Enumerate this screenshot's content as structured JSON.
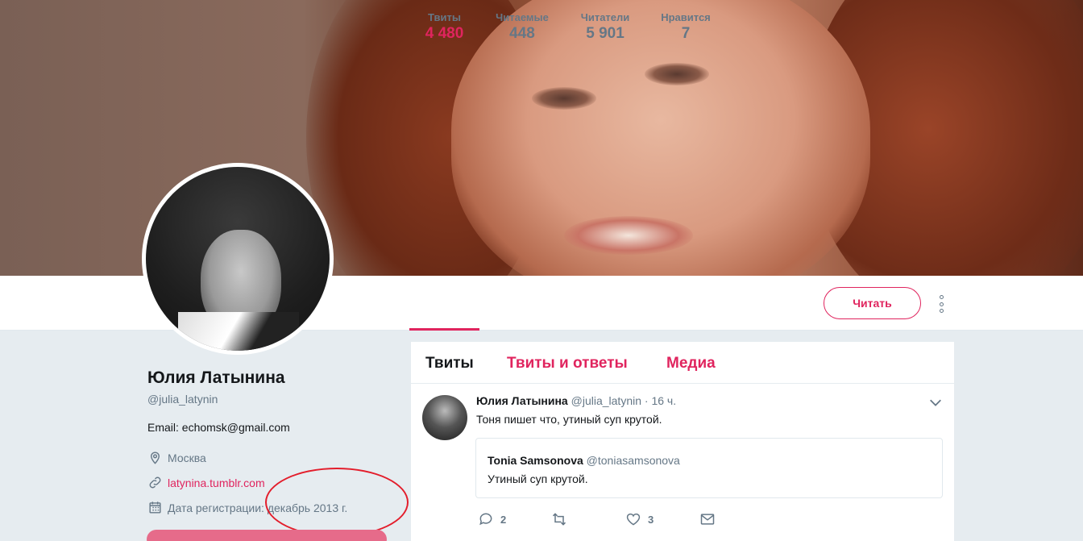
{
  "colors": {
    "accent": "#e0245e",
    "text": "#14171a",
    "muted": "#657786",
    "annotation": "#e31d2b"
  },
  "banner": {
    "image": "cover-photo-portrait"
  },
  "stats": [
    {
      "label": "Твиты",
      "value": "4 480"
    },
    {
      "label": "Читаемые",
      "value": "448"
    },
    {
      "label": "Читатели",
      "value": "5 901"
    },
    {
      "label": "Нравится",
      "value": "7"
    }
  ],
  "follow_button": "Читать",
  "profile": {
    "name": "Юлия Латынина",
    "handle": "@julia_latynin",
    "email": "Email: echomsk@gmail.com",
    "location": "Москва",
    "website": "latynina.tumblr.com",
    "joined": "Дата регистрации: декабрь 2013 г."
  },
  "tabs": [
    "Твиты",
    "Твиты и ответы",
    "Медиа"
  ],
  "tweet": {
    "author": "Юлия Латынина",
    "handle": "@julia_latynin",
    "time": "· 16 ч.",
    "text": "Тоня пишет что, утиный суп крутой.",
    "quote": {
      "author": "Tonia Samsonova",
      "handle": "@toniasamsonova",
      "text": "Утиный суп крутой."
    },
    "replies": "2",
    "likes": "3"
  }
}
